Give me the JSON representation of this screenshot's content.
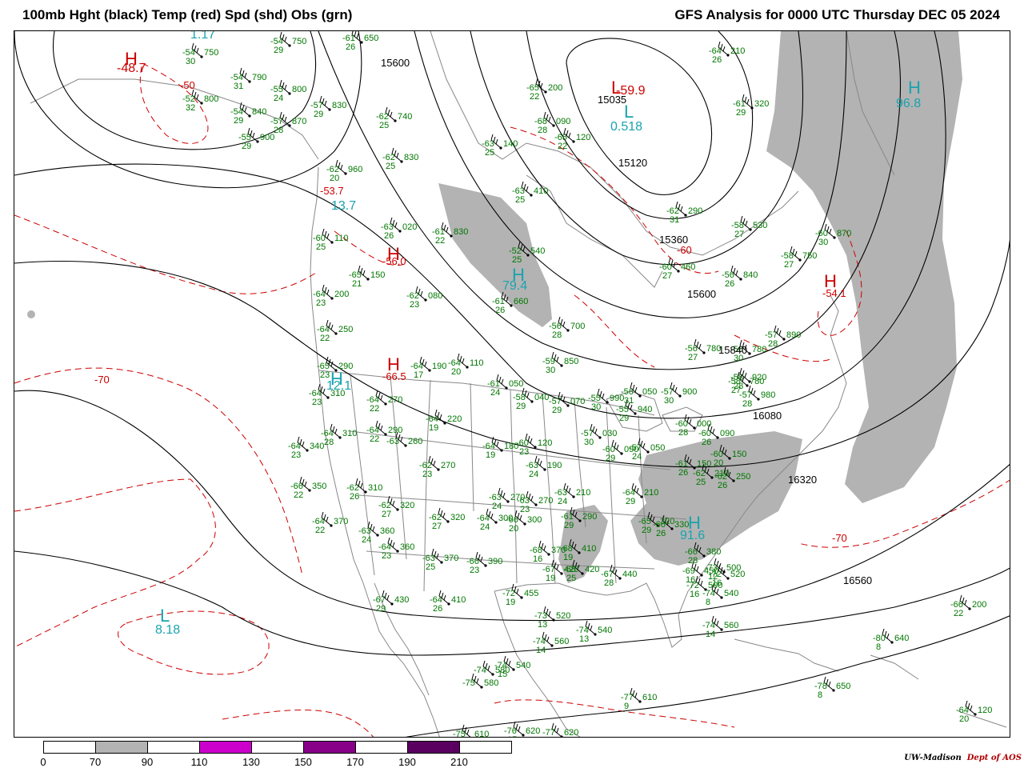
{
  "header": {
    "title_left": "100mb Hght (black) Temp (red) Spd (shd) Obs (grn)",
    "title_right": "GFS Analysis for 0000 UTC Thursday  DEC 05 2024"
  },
  "colors": {
    "height_contour": "#000000",
    "temperature_contour": "#cc0000",
    "observation": "#007700",
    "pressure_center_label": "#1aa3b0",
    "geography": "#888888",
    "speed_shade_70_90": "#b3b3b3"
  },
  "height_contours": [
    "15600",
    "15035",
    "15120",
    "15360",
    "15600",
    "15840",
    "16080",
    "16320",
    "16560"
  ],
  "pressure_centers": [
    {
      "letter": "H",
      "value": "-48.7",
      "kind": "temp"
    },
    {
      "letter": "",
      "value": "1.17",
      "kind": "speed"
    },
    {
      "letter": "L",
      "value": "-59.9",
      "kind": "temp"
    },
    {
      "letter": "L",
      "value": "0.518",
      "kind": "speed"
    },
    {
      "letter": "H",
      "value": "96.8",
      "kind": "speed"
    },
    {
      "letter": "H",
      "value": "-53.7",
      "kind": "temp"
    },
    {
      "letter": "",
      "value": "13.7",
      "kind": "speed"
    },
    {
      "letter": "H",
      "value": "-56.0",
      "kind": "temp"
    },
    {
      "letter": "H",
      "value": "79.4",
      "kind": "speed"
    },
    {
      "letter": "H",
      "value": "-54.1",
      "kind": "temp"
    },
    {
      "letter": "H",
      "value": "-66.5",
      "kind": "temp"
    },
    {
      "letter": "H",
      "value": "12.1",
      "kind": "speed"
    },
    {
      "letter": "H",
      "value": "91.6",
      "kind": "speed"
    },
    {
      "letter": "L",
      "value": "8.18",
      "kind": "speed"
    }
  ],
  "temperature_labels": [
    "-50",
    "-60",
    "-70",
    "-70"
  ],
  "observations": [
    {
      "t": "-54",
      "h": "750",
      "s": "30"
    },
    {
      "t": "-54",
      "h": "790",
      "s": "31"
    },
    {
      "t": "-52",
      "h": "800",
      "s": "32"
    },
    {
      "t": "-54",
      "h": "840",
      "s": "29"
    },
    {
      "t": "-55",
      "h": "900",
      "s": "29"
    },
    {
      "t": "-54",
      "h": "750",
      "s": "29"
    },
    {
      "t": "-55",
      "h": "800",
      "s": "24"
    },
    {
      "t": "-57",
      "h": "830",
      "s": "29"
    },
    {
      "t": "-57",
      "h": "870",
      "s": "28"
    },
    {
      "t": "-61",
      "h": "650",
      "s": "26"
    },
    {
      "t": "-62",
      "h": "740",
      "s": "25"
    },
    {
      "t": "-62",
      "h": "830",
      "s": "25"
    },
    {
      "t": "-62",
      "h": "960",
      "s": "20"
    },
    {
      "t": "-63",
      "h": "020",
      "s": "26"
    },
    {
      "t": "-61",
      "h": "830",
      "s": "22"
    },
    {
      "t": "-60",
      "h": "110",
      "s": "25"
    },
    {
      "t": "-65",
      "h": "150",
      "s": "21"
    },
    {
      "t": "-62",
      "h": "080",
      "s": "23"
    },
    {
      "t": "-64",
      "h": "200",
      "s": "23"
    },
    {
      "t": "-64",
      "h": "250",
      "s": "22"
    },
    {
      "t": "-65",
      "h": "290",
      "s": "23"
    },
    {
      "t": "-64",
      "h": "310",
      "s": "23"
    },
    {
      "t": "-64",
      "h": "270",
      "s": "22"
    },
    {
      "t": "-64",
      "h": "190",
      "s": "17"
    },
    {
      "t": "-64",
      "h": "110",
      "s": "20"
    },
    {
      "t": "-64",
      "h": "310",
      "s": "28"
    },
    {
      "t": "-64",
      "h": "340",
      "s": "23"
    },
    {
      "t": "-64",
      "h": "290",
      "s": "22"
    },
    {
      "t": "-63",
      "h": "260",
      "s": ""
    },
    {
      "t": "-64",
      "h": "220",
      "s": "19"
    },
    {
      "t": "-62",
      "h": "270",
      "s": "23"
    },
    {
      "t": "-66",
      "h": "350",
      "s": "22"
    },
    {
      "t": "-62",
      "h": "310",
      "s": "26"
    },
    {
      "t": "-62",
      "h": "320",
      "s": "27"
    },
    {
      "t": "-64",
      "h": "370",
      "s": "22"
    },
    {
      "t": "-63",
      "h": "360",
      "s": "24"
    },
    {
      "t": "-64",
      "h": "360",
      "s": "23"
    },
    {
      "t": "-62",
      "h": "320",
      "s": "27"
    },
    {
      "t": "-63",
      "h": "370",
      "s": "25"
    },
    {
      "t": "-66",
      "h": "390",
      "s": "23"
    },
    {
      "t": "-67",
      "h": "430",
      "s": "29"
    },
    {
      "t": "-64",
      "h": "410",
      "s": "26"
    },
    {
      "t": "-65",
      "h": "200",
      "s": "22"
    },
    {
      "t": "-63",
      "h": "140",
      "s": "25"
    },
    {
      "t": "-65",
      "h": "120",
      "s": "22"
    },
    {
      "t": "-64",
      "h": "210",
      "s": "26"
    },
    {
      "t": "-68",
      "h": "090",
      "s": "28"
    },
    {
      "t": "-61",
      "h": "320",
      "s": "29"
    },
    {
      "t": "-63",
      "h": "410",
      "s": "25"
    },
    {
      "t": "-62",
      "h": "290",
      "s": "31"
    },
    {
      "t": "-58",
      "h": "530",
      "s": "27"
    },
    {
      "t": "-60",
      "h": "870",
      "s": "30"
    },
    {
      "t": "-58",
      "h": "750",
      "s": "27"
    },
    {
      "t": "-56",
      "h": "840",
      "s": "26"
    },
    {
      "t": "-60",
      "h": "460",
      "s": "27"
    },
    {
      "t": "-52",
      "h": "540",
      "s": "25"
    },
    {
      "t": "-61",
      "h": "660",
      "s": "26"
    },
    {
      "t": "-56",
      "h": "700",
      "s": "28"
    },
    {
      "t": "-56",
      "h": "780",
      "s": "27"
    },
    {
      "t": "-58",
      "h": "780",
      "s": "27"
    },
    {
      "t": "-57",
      "h": "890",
      "s": "28"
    },
    {
      "t": "-56",
      "h": "780",
      "s": "30"
    },
    {
      "t": "-59",
      "h": "850",
      "s": "30"
    },
    {
      "t": "-58",
      "h": "920",
      "s": "28"
    },
    {
      "t": "-57",
      "h": "980",
      "s": "28"
    },
    {
      "t": "-61",
      "h": "050",
      "s": "24"
    },
    {
      "t": "-58",
      "h": "040",
      "s": "29"
    },
    {
      "t": "-57",
      "h": "070",
      "s": "29"
    },
    {
      "t": "-55",
      "h": "990",
      "s": "30"
    },
    {
      "t": "-56",
      "h": "050",
      "s": "31"
    },
    {
      "t": "-55",
      "h": "940",
      "s": "29"
    },
    {
      "t": "-57",
      "h": "900",
      "s": "30"
    },
    {
      "t": "-60",
      "h": "000",
      "s": "28"
    },
    {
      "t": "-60",
      "h": "090",
      "s": "26"
    },
    {
      "t": "-60",
      "h": "150",
      "s": "20"
    },
    {
      "t": "-57",
      "h": "030",
      "s": "30"
    },
    {
      "t": "-60",
      "h": "090",
      "s": "29"
    },
    {
      "t": "-57",
      "h": "050",
      "s": "24"
    },
    {
      "t": "-64",
      "h": "180",
      "s": "19"
    },
    {
      "t": "-60",
      "h": "120",
      "s": "23"
    },
    {
      "t": "-63",
      "h": "190",
      "s": "24"
    },
    {
      "t": "-63",
      "h": "270",
      "s": "24"
    },
    {
      "t": "-63",
      "h": "270",
      "s": "23"
    },
    {
      "t": "-64",
      "h": "300",
      "s": "24"
    },
    {
      "t": "-66",
      "h": "300",
      "s": "20"
    },
    {
      "t": "-61",
      "h": "290",
      "s": "29"
    },
    {
      "t": "-63",
      "h": "210",
      "s": "24"
    },
    {
      "t": "-64",
      "h": "210",
      "s": "29"
    },
    {
      "t": "-61",
      "h": "150",
      "s": "26"
    },
    {
      "t": "-62",
      "h": "210",
      "s": "25"
    },
    {
      "t": "-62",
      "h": "250",
      "s": "26"
    },
    {
      "t": "-65",
      "h": "320",
      "s": "29"
    },
    {
      "t": "-66",
      "h": "330",
      "s": "26"
    },
    {
      "t": "-66",
      "h": "380",
      "s": "28"
    },
    {
      "t": "-68",
      "h": "410",
      "s": "19"
    },
    {
      "t": "-68",
      "h": "370",
      "s": "16"
    },
    {
      "t": "-68",
      "h": "420",
      "s": "25"
    },
    {
      "t": "-67",
      "h": "420",
      "s": "19"
    },
    {
      "t": "-67",
      "h": "440",
      "s": "28"
    },
    {
      "t": "-69",
      "h": "450",
      "s": "16"
    },
    {
      "t": "-72",
      "h": "455",
      "s": "19"
    },
    {
      "t": "-73",
      "h": "500",
      "s": "12"
    },
    {
      "t": "-72",
      "h": "500",
      "s": "16"
    },
    {
      "t": "-74",
      "h": "540",
      "s": "8"
    },
    {
      "t": "-74",
      "h": "560",
      "s": "14"
    },
    {
      "t": "-73",
      "h": "520",
      "s": "13"
    },
    {
      "t": "-74",
      "h": "540",
      "s": "13"
    },
    {
      "t": "-72",
      "h": "520",
      "s": "16"
    },
    {
      "t": "-74",
      "h": "540",
      "s": "15"
    },
    {
      "t": "-74",
      "h": "560",
      "s": "14"
    },
    {
      "t": "-74",
      "h": "580",
      "s": ""
    },
    {
      "t": "-75",
      "h": "580",
      "s": ""
    },
    {
      "t": "-75",
      "h": "610",
      "s": ""
    },
    {
      "t": "-76",
      "h": "620",
      "s": "15"
    },
    {
      "t": "-77",
      "h": "620",
      "s": "10"
    },
    {
      "t": "-77",
      "h": "610",
      "s": "9"
    },
    {
      "t": "-78",
      "h": "650",
      "s": "8"
    },
    {
      "t": "-80",
      "h": "640",
      "s": "8"
    },
    {
      "t": "-66",
      "h": "200",
      "s": "22"
    },
    {
      "t": "-64",
      "h": "120",
      "s": "20"
    }
  ],
  "legend": {
    "ticks": [
      "0",
      "70",
      "90",
      "110",
      "130",
      "150",
      "170",
      "190",
      "210"
    ],
    "colors": [
      "#ffffff",
      "#b3b3b3",
      "#ffffff",
      "#cc00cc",
      "#ffffff",
      "#880088",
      "#ffffff",
      "#5a0060",
      "#ffffff"
    ]
  },
  "credit": {
    "org": "UW-Madison",
    "dept": "Dept of AOS"
  }
}
